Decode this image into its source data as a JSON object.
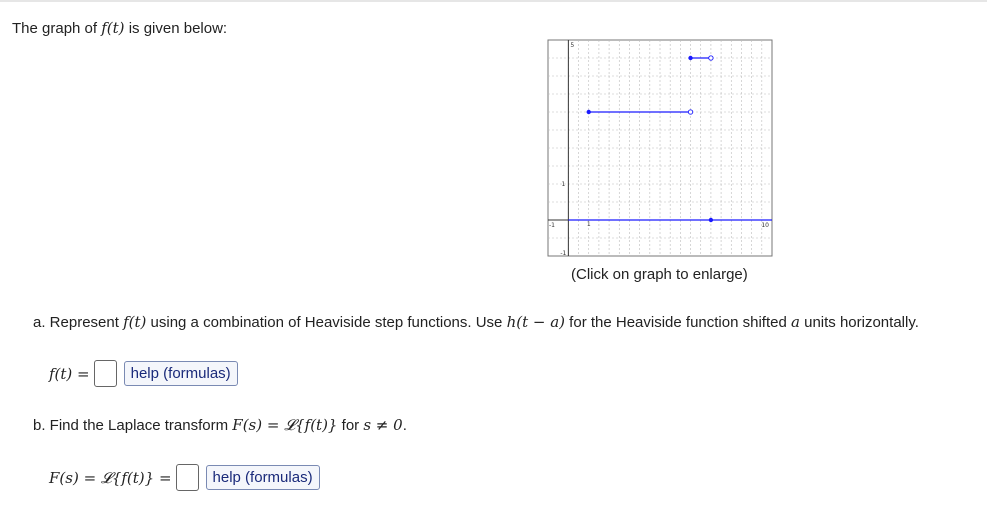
{
  "intro": {
    "prefix": "The graph of ",
    "func": "f(t)",
    "suffix": " is given below:"
  },
  "graph": {
    "xlim": [
      -1,
      10
    ],
    "ylim": [
      -1,
      5
    ],
    "tick_labels": {
      "ymax": "5",
      "y1": "1",
      "y_neg": "-1",
      "x_neg": "-1",
      "x_mid": "1",
      "x_max": "10"
    },
    "segments": [
      {
        "x1": 1,
        "x2": 6,
        "y": 3,
        "closed_left": true,
        "open_right": true
      },
      {
        "x1": 6,
        "x2": 7,
        "y": 4.5,
        "closed_left": true,
        "open_right": true
      }
    ],
    "closed_point": {
      "x": 7,
      "y": 0
    },
    "colors": {
      "curve": "#1a1aff",
      "axis": "#333333",
      "grid": "#bbbbbb",
      "frame": "#777777"
    }
  },
  "caption": "(Click on graph to enlarge)",
  "part_a": {
    "prefix": "a. Represent ",
    "func": "f(t)",
    "middle": " using a combination of Heaviside step functions. Use ",
    "hfunc": "h(t − a)",
    "after": " for the Heaviside function shifted ",
    "avar": "a",
    "suffix": " units horizontally."
  },
  "eq_a": {
    "lhs": "f(t) =",
    "help": "help (formulas)"
  },
  "part_b": {
    "prefix": "b. Find the Laplace transform ",
    "math": "F(s) = 𝓛{f(t)}",
    "middle": " for ",
    "cond": "s ≠ 0",
    "suffix": "."
  },
  "eq_b": {
    "lhs": "F(s) = 𝓛{f(t)} =",
    "help": "help (formulas)"
  }
}
